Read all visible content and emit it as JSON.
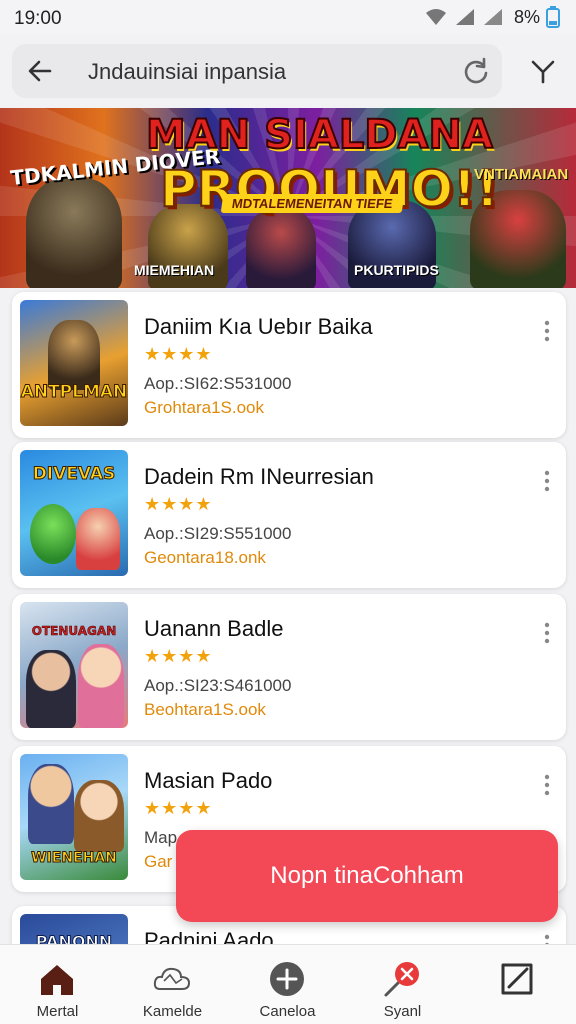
{
  "status_bar": {
    "time": "19:00",
    "battery": "8%"
  },
  "search": {
    "query": "Jndauinsiai  inpansia"
  },
  "banner": {
    "title_line1": "MAN SIALDANA",
    "title_line2": "PRQOUMO!!",
    "subtitle": "MDTALEMENEITAN TIEFE",
    "left_text": "TDKALMIN DIQVER",
    "right_text": "VNTIAMAIAN",
    "bottom_left": "MIEMEHIAN",
    "bottom_right": "PKURTIPIDS"
  },
  "apps": [
    {
      "title": "Daniim Kıa Uebır Baika",
      "rating": "★★★★",
      "meta": "Aop.:SI62:S531000",
      "sub": "Grohtara1S.ook",
      "thumb_label": "ANTPLMAN"
    },
    {
      "title": "Dadein Rm INeurresian",
      "rating": "★★★★",
      "meta": "Aop.:SI29:S551000",
      "sub": "Geontara18.onk",
      "thumb_label": "DIVEVAS"
    },
    {
      "title": "Uanann Badle",
      "rating": "★★★★",
      "meta": "Aop.:SI23:S461000",
      "sub": "Beohtara1S.ook",
      "thumb_label": "OTENUAGAN"
    },
    {
      "title": "Masian Pado",
      "rating": "★★★★",
      "meta": "Map",
      "sub": "Gar",
      "thumb_label": "WIENEHAN"
    },
    {
      "title": "Padnini Aado",
      "thumb_label": "PANONN"
    }
  ],
  "toast": {
    "text": "Nopn tinaCohham"
  },
  "nav": [
    {
      "label": "Mertal",
      "icon": "home-icon"
    },
    {
      "label": "Kamelde",
      "icon": "cloud-map-icon"
    },
    {
      "label": "Caneloa",
      "icon": "add-circle-icon"
    },
    {
      "label": "Syanl",
      "icon": "search-close-icon"
    },
    {
      "label": "",
      "icon": "external-edit-icon"
    }
  ],
  "colors": {
    "toast": "#f34856",
    "stars": "#f2a20a",
    "sub_text": "#e08a0a",
    "active_nav": "#5a1f14"
  }
}
